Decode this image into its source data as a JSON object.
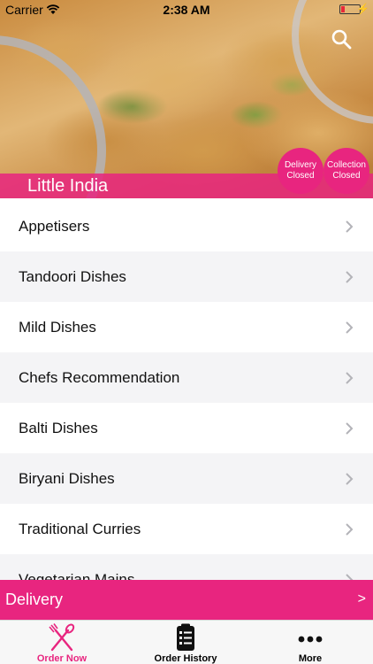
{
  "status_bar": {
    "carrier": "Carrier",
    "time": "2:38 AM"
  },
  "restaurant": {
    "name": "Little India"
  },
  "status_pills": {
    "delivery": {
      "line1": "Delivery",
      "line2": "Closed"
    },
    "collection": {
      "line1": "Collection",
      "line2": "Closed"
    }
  },
  "menu": {
    "categories": [
      "Appetisers",
      "Tandoori Dishes",
      "Mild Dishes",
      "Chefs Recommendation",
      "Balti Dishes",
      "Biryani Dishes",
      "Traditional Curries",
      "Vegetarian Mains"
    ]
  },
  "order_mode": {
    "label": "Delivery",
    "arrow": ">"
  },
  "tabs": [
    {
      "label": "Order Now",
      "icon": "fork-knife-icon",
      "active": true
    },
    {
      "label": "Order History",
      "icon": "clipboard-list-icon",
      "active": false
    },
    {
      "label": "More",
      "icon": "more-dots-icon",
      "active": false
    }
  ],
  "colors": {
    "accent": "#e8257f",
    "tab_active": "#e8257f",
    "tab_inactive": "#111111"
  }
}
